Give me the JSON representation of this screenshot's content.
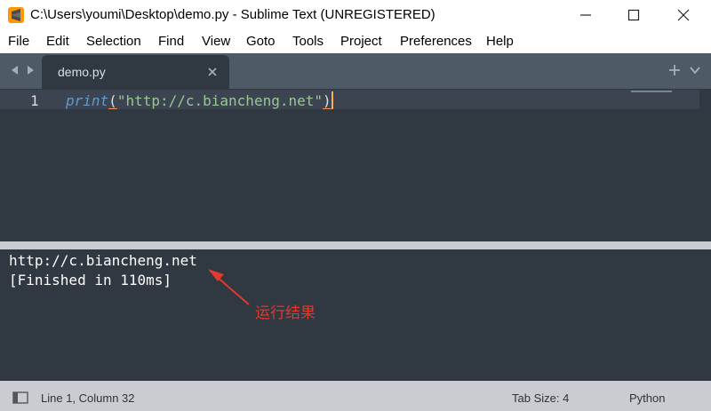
{
  "window": {
    "title": "C:\\Users\\youmi\\Desktop\\demo.py - Sublime Text (UNREGISTERED)",
    "app_icon": "sublime-text-icon",
    "controls": [
      "minimize-icon",
      "maximize-icon",
      "close-icon"
    ]
  },
  "menu": {
    "items": [
      "File",
      "Edit",
      "Selection",
      "Find",
      "View",
      "Goto",
      "Tools",
      "Project",
      "Preferences",
      "Help"
    ]
  },
  "tabs": {
    "active": {
      "label": "demo.py",
      "close_glyph": "×"
    },
    "nav_icons": [
      "triangle-left-icon",
      "triangle-right-icon"
    ],
    "new_tab_glyph": "+",
    "overflow_icon": "chevron-down-icon"
  },
  "editor": {
    "line_number": "1",
    "code": {
      "func": "print",
      "open_paren": "(",
      "string": "\"http://c.biancheng.net\"",
      "close_paren": ")"
    }
  },
  "output": {
    "lines": [
      "http://c.biancheng.net",
      "[Finished in 110ms]"
    ],
    "annotation": "运行结果",
    "annotation_color": "#e0392d"
  },
  "statusbar": {
    "position": "Line 1, Column 32",
    "tab_size": "Tab Size: 4",
    "syntax": "Python"
  },
  "colors": {
    "editor_bg": "#303841",
    "tabbar_bg": "#4e5a65",
    "func": "#6699cc",
    "string": "#99c794",
    "caret": "#f9ae58"
  }
}
